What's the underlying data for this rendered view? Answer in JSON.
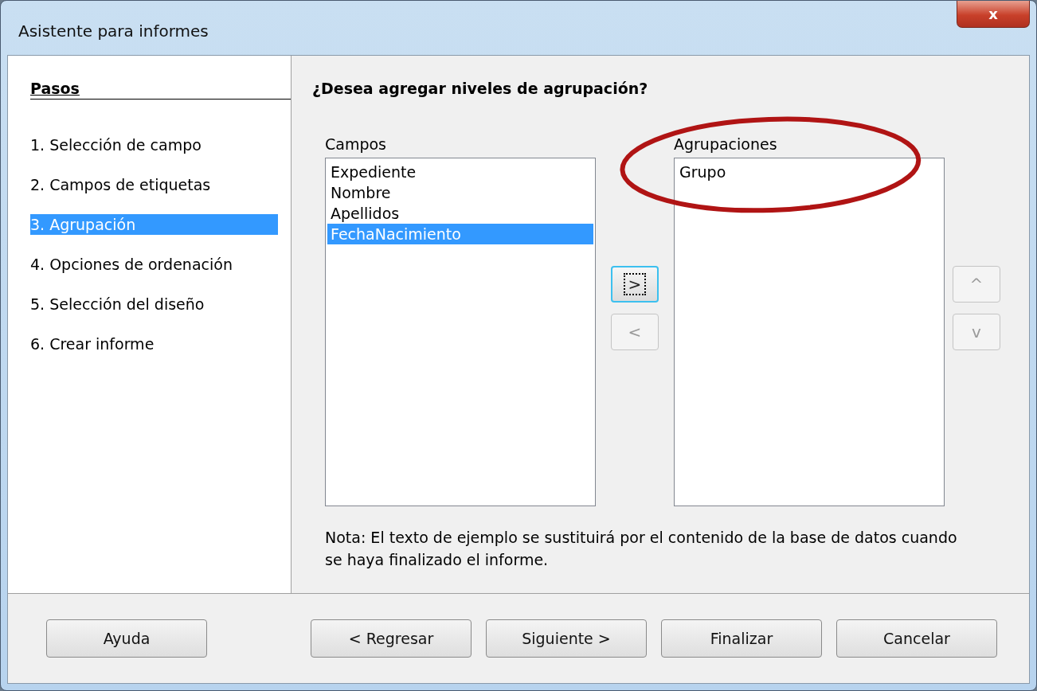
{
  "window": {
    "title": "Asistente para informes",
    "close": "x"
  },
  "steps": {
    "heading": "Pasos",
    "items": [
      {
        "label": "1. Selección de campo",
        "selected": false
      },
      {
        "label": "2. Campos de etiquetas",
        "selected": false
      },
      {
        "label": "3. Agrupación",
        "selected": true
      },
      {
        "label": "4. Opciones de ordenación",
        "selected": false
      },
      {
        "label": "5. Selección del diseño",
        "selected": false
      },
      {
        "label": "6. Crear informe",
        "selected": false
      }
    ]
  },
  "question": "¿Desea agregar niveles de agrupación?",
  "fields": {
    "label": "Campos",
    "items": [
      {
        "label": "Expediente",
        "selected": false
      },
      {
        "label": "Nombre",
        "selected": false
      },
      {
        "label": "Apellidos",
        "selected": false
      },
      {
        "label": "FechaNacimiento",
        "selected": true
      }
    ]
  },
  "move_buttons": [
    {
      "label": ">",
      "disabled": false,
      "focused": true
    },
    {
      "label": "<",
      "disabled": true,
      "focused": false
    }
  ],
  "groupings": {
    "label": "Agrupaciones",
    "items": [
      {
        "label": "Grupo",
        "selected": false
      }
    ]
  },
  "order_buttons": [
    {
      "label": "^",
      "disabled": true
    },
    {
      "label": "v",
      "disabled": true
    }
  ],
  "note": "Nota: El texto de ejemplo se sustituirá por el contenido de la base de datos cuando se haya finalizado el informe.",
  "annotation": {
    "kind": "ellipse",
    "color": "#b01414"
  },
  "help_button": {
    "label": "Ayuda"
  },
  "buttons": [
    {
      "label": "< Regresar"
    },
    {
      "label": "Siguiente >"
    },
    {
      "label": "Finalizar"
    },
    {
      "label": "Cancelar"
    }
  ]
}
